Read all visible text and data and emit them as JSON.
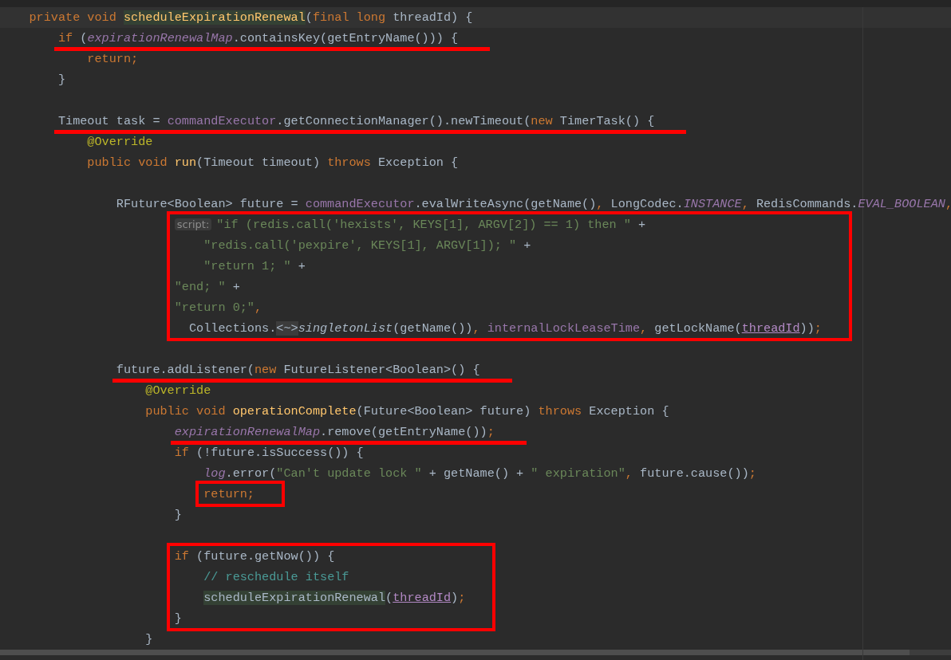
{
  "editor": {
    "lines": [
      {
        "kind": "code",
        "current": true,
        "underlined": false,
        "tokens": [
          {
            "text": "private void ",
            "kind": "kw"
          },
          {
            "text": "scheduleExpirationRenewal",
            "kind": "decl-hl"
          },
          {
            "text": "(",
            "kind": "plain"
          },
          {
            "text": "final long ",
            "kind": "kw"
          },
          {
            "text": "threadId) {",
            "kind": "plain"
          }
        ],
        "children": [
          {
            "kind": "code",
            "current": false,
            "underlined": true,
            "tokens": [
              {
                "text": "if ",
                "kind": "kw"
              },
              {
                "text": "(",
                "kind": "plain"
              },
              {
                "text": "expirationRenewalMap",
                "kind": "field"
              },
              {
                "text": ".containsKey(getEntryName())) {",
                "kind": "plain"
              }
            ],
            "children": [
              {
                "kind": "code",
                "current": false,
                "underlined": false,
                "tokens": [
                  {
                    "text": "return;",
                    "kind": "kw"
                  }
                ]
              }
            ]
          },
          {
            "kind": "code",
            "current": false,
            "underlined": false,
            "tokens": [
              {
                "text": "}",
                "kind": "plain"
              }
            ]
          },
          {
            "kind": "blank"
          },
          {
            "kind": "code",
            "current": false,
            "underlined": true,
            "tokens": [
              {
                "text": "Timeout task = ",
                "kind": "plain"
              },
              {
                "text": "commandExecutor",
                "kind": "inst"
              },
              {
                "text": ".getConnectionManager().newTimeout(",
                "kind": "plain"
              },
              {
                "text": "new ",
                "kind": "kw"
              },
              {
                "text": "TimerTask() {",
                "kind": "plain"
              }
            ],
            "children": [
              {
                "kind": "code",
                "current": false,
                "underlined": false,
                "tokens": [
                  {
                    "text": "@Override",
                    "kind": "ann"
                  }
                ]
              },
              {
                "kind": "code",
                "current": false,
                "underlined": false,
                "tokens": [
                  {
                    "text": "public void ",
                    "kind": "kw"
                  },
                  {
                    "text": "run",
                    "kind": "decl"
                  },
                  {
                    "text": "(Timeout timeout) ",
                    "kind": "plain"
                  },
                  {
                    "text": "throws ",
                    "kind": "kw"
                  },
                  {
                    "text": "Exception {",
                    "kind": "plain"
                  }
                ],
                "children": [
                  {
                    "kind": "blank"
                  },
                  {
                    "kind": "code",
                    "current": false,
                    "underlined": false,
                    "tokens": [
                      {
                        "text": "RFuture<Boolean> future = ",
                        "kind": "plain"
                      },
                      {
                        "text": "commandExecutor",
                        "kind": "inst"
                      },
                      {
                        "text": ".evalWriteAsync(getName()",
                        "kind": "plain"
                      },
                      {
                        "text": ", ",
                        "kind": "punct"
                      },
                      {
                        "text": "LongCodec.",
                        "kind": "plain"
                      },
                      {
                        "text": "INSTANCE",
                        "kind": "static"
                      },
                      {
                        "text": ", ",
                        "kind": "punct"
                      },
                      {
                        "text": "RedisCommands.",
                        "kind": "plain"
                      },
                      {
                        "text": "EVAL_BOOLEAN",
                        "kind": "static"
                      },
                      {
                        "text": ",",
                        "kind": "punct"
                      }
                    ],
                    "continuation": [
                      {
                        "kind": "boxed",
                        "lines": [
                          {
                            "kind": "code",
                            "current": false,
                            "underlined": false,
                            "tokens": [
                              {
                                "text": "script:",
                                "kind": "hint"
                              },
                              {
                                "text": "\"if (redis.call('hexists', KEYS[1], ARGV[2]) == 1) then \"",
                                "kind": "str"
                              },
                              {
                                "text": " +",
                                "kind": "plain"
                              }
                            ],
                            "children": [
                              {
                                "kind": "code",
                                "current": false,
                                "underlined": false,
                                "tokens": [
                                  {
                                    "text": "\"redis.call('pexpire', KEYS[1], ARGV[1]); \"",
                                    "kind": "str"
                                  },
                                  {
                                    "text": " +",
                                    "kind": "plain"
                                  }
                                ]
                              },
                              {
                                "kind": "code",
                                "current": false,
                                "underlined": false,
                                "tokens": [
                                  {
                                    "text": "\"return 1; \"",
                                    "kind": "str"
                                  },
                                  {
                                    "text": " +",
                                    "kind": "plain"
                                  }
                                ]
                              }
                            ]
                          },
                          {
                            "kind": "code",
                            "current": false,
                            "underlined": false,
                            "tokens": [
                              {
                                "text": "\"end; \"",
                                "kind": "str"
                              },
                              {
                                "text": " +",
                                "kind": "plain"
                              }
                            ]
                          },
                          {
                            "kind": "code",
                            "current": false,
                            "underlined": false,
                            "tokens": [
                              {
                                "text": "\"return 0;\"",
                                "kind": "str"
                              },
                              {
                                "text": ",",
                                "kind": "punct"
                              }
                            ]
                          },
                          {
                            "kind": "code",
                            "current": false,
                            "underlined": false,
                            "tokens": [
                              {
                                "text": "  Collections.",
                                "kind": "plain"
                              },
                              {
                                "text": "<~>",
                                "kind": "fold"
                              },
                              {
                                "text": "singletonList",
                                "kind": "static-call"
                              },
                              {
                                "text": "(getName())",
                                "kind": "plain"
                              },
                              {
                                "text": ", ",
                                "kind": "punct"
                              },
                              {
                                "text": "internalLockLeaseTime",
                                "kind": "inst"
                              },
                              {
                                "text": ", ",
                                "kind": "punct"
                              },
                              {
                                "text": "getLockName(",
                                "kind": "plain"
                              },
                              {
                                "text": "threadId",
                                "kind": "paramref"
                              },
                              {
                                "text": "))",
                                "kind": "plain"
                              },
                              {
                                "text": ";",
                                "kind": "punct"
                              }
                            ]
                          }
                        ]
                      }
                    ]
                  },
                  {
                    "kind": "blank"
                  },
                  {
                    "kind": "code",
                    "current": false,
                    "underlined": true,
                    "tokens": [
                      {
                        "text": "future.addListener(",
                        "kind": "plain"
                      },
                      {
                        "text": "new ",
                        "kind": "kw"
                      },
                      {
                        "text": "FutureListener<Boolean>() {",
                        "kind": "plain"
                      }
                    ],
                    "children": [
                      {
                        "kind": "code",
                        "current": false,
                        "underlined": false,
                        "tokens": [
                          {
                            "text": "@Override",
                            "kind": "ann"
                          }
                        ]
                      },
                      {
                        "kind": "code",
                        "current": false,
                        "underlined": false,
                        "tokens": [
                          {
                            "text": "public void ",
                            "kind": "kw"
                          },
                          {
                            "text": "operationComplete",
                            "kind": "decl"
                          },
                          {
                            "text": "(Future<Boolean> future) ",
                            "kind": "plain"
                          },
                          {
                            "text": "throws ",
                            "kind": "kw"
                          },
                          {
                            "text": "Exception {",
                            "kind": "plain"
                          }
                        ],
                        "children": [
                          {
                            "kind": "code",
                            "current": false,
                            "underlined": true,
                            "tokens": [
                              {
                                "text": "expirationRenewalMap",
                                "kind": "field"
                              },
                              {
                                "text": ".remove(getEntryName())",
                                "kind": "plain"
                              },
                              {
                                "text": ";",
                                "kind": "punct"
                              }
                            ]
                          },
                          {
                            "kind": "code",
                            "current": false,
                            "underlined": false,
                            "tokens": [
                              {
                                "text": "if ",
                                "kind": "kw"
                              },
                              {
                                "text": "(!future.isSuccess()) {",
                                "kind": "plain"
                              }
                            ],
                            "children": [
                              {
                                "kind": "code",
                                "current": false,
                                "underlined": false,
                                "tokens": [
                                  {
                                    "text": "log",
                                    "kind": "field"
                                  },
                                  {
                                    "text": ".error(",
                                    "kind": "plain"
                                  },
                                  {
                                    "text": "\"Can't update lock \"",
                                    "kind": "str"
                                  },
                                  {
                                    "text": " + getName() + ",
                                    "kind": "plain"
                                  },
                                  {
                                    "text": "\" expiration\"",
                                    "kind": "str"
                                  },
                                  {
                                    "text": ", ",
                                    "kind": "punct"
                                  },
                                  {
                                    "text": "future.cause())",
                                    "kind": "plain"
                                  },
                                  {
                                    "text": ";",
                                    "kind": "punct"
                                  }
                                ]
                              },
                              {
                                "kind": "boxed",
                                "lines": [
                                  {
                                    "kind": "code",
                                    "current": false,
                                    "underlined": false,
                                    "tokens": [
                                      {
                                        "text": "return;",
                                        "kind": "kw"
                                      }
                                    ]
                                  }
                                ]
                              }
                            ]
                          },
                          {
                            "kind": "code",
                            "current": false,
                            "underlined": false,
                            "tokens": [
                              {
                                "text": "}",
                                "kind": "plain"
                              }
                            ]
                          },
                          {
                            "kind": "blank"
                          },
                          {
                            "kind": "boxed",
                            "lines": [
                              {
                                "kind": "code",
                                "current": false,
                                "underlined": false,
                                "tokens": [
                                  {
                                    "text": "if ",
                                    "kind": "kw"
                                  },
                                  {
                                    "text": "(future.getNow()) {",
                                    "kind": "plain"
                                  }
                                ],
                                "children": [
                                  {
                                    "kind": "code",
                                    "current": false,
                                    "underlined": false,
                                    "tokens": [
                                      {
                                        "text": "// reschedule itself",
                                        "kind": "comment"
                                      }
                                    ]
                                  },
                                  {
                                    "kind": "code",
                                    "current": false,
                                    "underlined": false,
                                    "tokens": [
                                      {
                                        "text": "scheduleExpirationRenewal",
                                        "kind": "call-hl"
                                      },
                                      {
                                        "text": "(",
                                        "kind": "plain"
                                      },
                                      {
                                        "text": "threadId",
                                        "kind": "paramref"
                                      },
                                      {
                                        "text": ")",
                                        "kind": "plain"
                                      },
                                      {
                                        "text": ";",
                                        "kind": "punct"
                                      }
                                    ]
                                  }
                                ]
                              },
                              {
                                "kind": "code",
                                "current": false,
                                "underlined": false,
                                "tokens": [
                                  {
                                    "text": "}",
                                    "kind": "plain"
                                  }
                                ]
                              }
                            ]
                          }
                        ]
                      },
                      {
                        "kind": "code",
                        "current": false,
                        "underlined": false,
                        "tokens": [
                          {
                            "text": "}",
                            "kind": "plain"
                          }
                        ]
                      }
                    ]
                  }
                ]
              }
            ]
          }
        ]
      }
    ]
  }
}
